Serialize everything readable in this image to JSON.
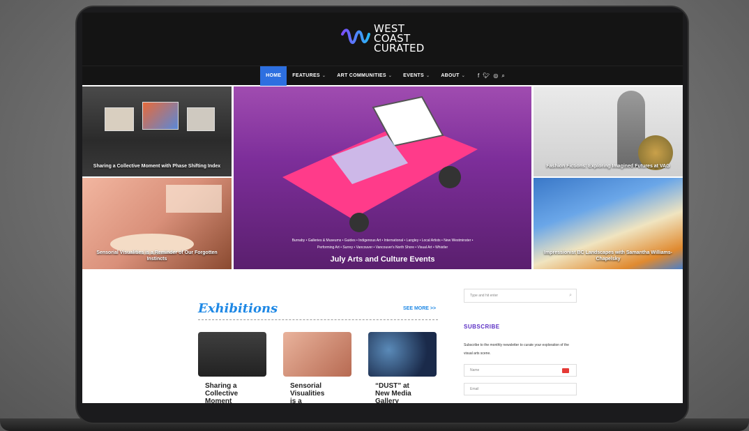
{
  "brand": {
    "line1": "WEST",
    "line2": "COAST",
    "line3": "CURATED",
    "accent": "#6a4cff"
  },
  "nav": {
    "home": "HOME",
    "features": "FEATURES",
    "art_communities": "ART COMMUNITIES",
    "events": "EVENTS",
    "about": "ABOUT",
    "icons": [
      "facebook-icon",
      "twitter-icon",
      "instagram-icon",
      "search-icon"
    ]
  },
  "featured": {
    "tile1": "Sharing a Collective Moment with Phase Shifting Index",
    "tile2": "Sensorial Visualities is a Reminder of Our Forgotten Instincts",
    "main_tags_line1": "Burnaby  •  Galleries & Museums  •  Guides  •  Indigenous Art  •  International  •  Langley  •  Local Artists  •  New Westminster  •",
    "main_tags_line2": "Performing Art  •  Surrey  •  Vancouver  •  Vancouver's North Shore  •  Visual Art  •  Whistler",
    "main_title": "July Arts and Culture Events",
    "tile4": "Fashion Fictions: Exploring Imagined Futures at VAG",
    "tile5": "Impressionist BC Landscapes with Samantha Williams-Chapelsky"
  },
  "exhibitions": {
    "title": "Exhibitions",
    "see_more": "SEE MORE >>",
    "cards": [
      {
        "title": "Sharing a Collective Moment with"
      },
      {
        "title": "Sensorial Visualities is a Reminder of Our"
      },
      {
        "title": "“DUST” at New Media Gallery"
      }
    ]
  },
  "sidebar": {
    "search_placeholder": "Type and hit enter",
    "subscribe_title": "SUBSCRIBE",
    "subscribe_text": "Subscribe to the monthly newsletter to curate your exploration of the visual arts scene.",
    "name_placeholder": "Name",
    "email_placeholder": "Email"
  }
}
